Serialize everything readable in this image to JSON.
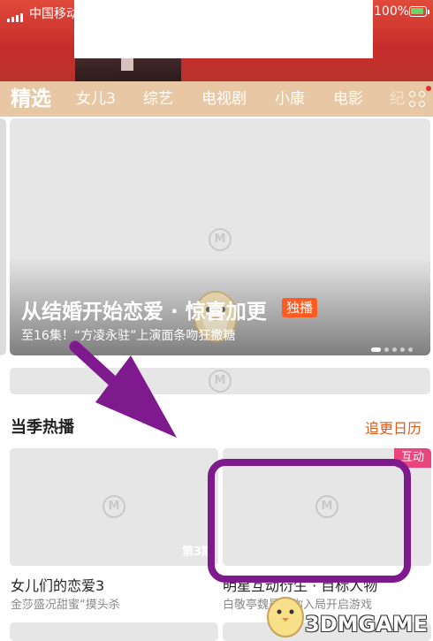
{
  "status_bar": {
    "carrier": "中国移动",
    "battery": "100%"
  },
  "tabs": [
    {
      "label": "精选"
    },
    {
      "label": "女儿3"
    },
    {
      "label": "综艺"
    },
    {
      "label": "电视剧"
    },
    {
      "label": "小康"
    },
    {
      "label": "电影"
    },
    {
      "label": "纪"
    }
  ],
  "carousel": {
    "title": "从结婚开始恋爱 · 惊喜加更",
    "badge": "独播",
    "subtitle": "至16集！“方凌永驻”上演面条吻狂撒糖",
    "slide_count": 5,
    "active_slide": 1
  },
  "section": {
    "title": "当季热播",
    "schedule_link": "追更日历"
  },
  "cards": [
    {
      "title": "女儿们的恋爱3",
      "subtitle": "金莎盛况甜蜜“摸头杀",
      "episode": "第3期"
    },
    {
      "title": "明星互动衍生 · 目标人物",
      "subtitle": "白敬亭魏晨带你入局开启游戏",
      "badge": "互动"
    }
  ],
  "watermark": {
    "text": "3DMGAME"
  },
  "colors": {
    "tab_bar": "#e8c7a4",
    "accent": "#e05a1e",
    "exclusive_badge": "#ff5a1f",
    "interactive_badge": "#e9457c",
    "annotation": "#7f1a8e",
    "hero_red": "#c62c2a"
  },
  "icons": [
    "signal-icon",
    "battery-icon",
    "channel-menu-icon",
    "placeholder-logo-icon",
    "mascot-icon"
  ]
}
